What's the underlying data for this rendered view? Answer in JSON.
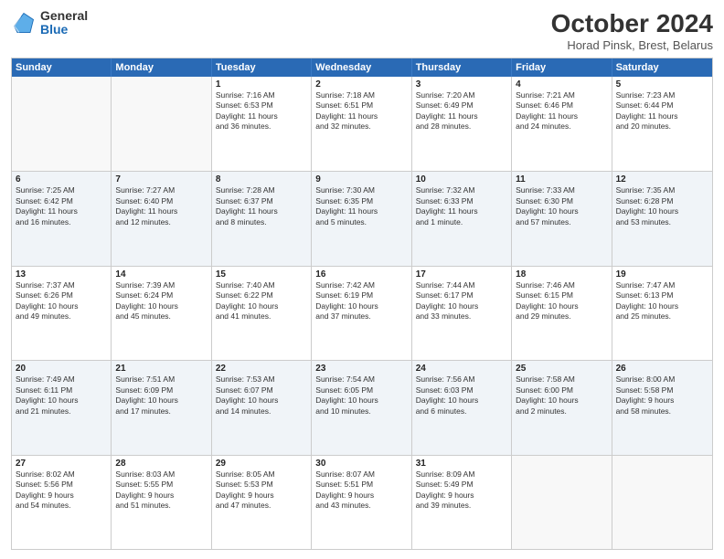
{
  "logo": {
    "general": "General",
    "blue": "Blue"
  },
  "header": {
    "month": "October 2024",
    "location": "Horad Pinsk, Brest, Belarus"
  },
  "days": [
    "Sunday",
    "Monday",
    "Tuesday",
    "Wednesday",
    "Thursday",
    "Friday",
    "Saturday"
  ],
  "weeks": [
    [
      {
        "day": "",
        "content": ""
      },
      {
        "day": "",
        "content": ""
      },
      {
        "day": "1",
        "content": "Sunrise: 7:16 AM\nSunset: 6:53 PM\nDaylight: 11 hours\nand 36 minutes."
      },
      {
        "day": "2",
        "content": "Sunrise: 7:18 AM\nSunset: 6:51 PM\nDaylight: 11 hours\nand 32 minutes."
      },
      {
        "day": "3",
        "content": "Sunrise: 7:20 AM\nSunset: 6:49 PM\nDaylight: 11 hours\nand 28 minutes."
      },
      {
        "day": "4",
        "content": "Sunrise: 7:21 AM\nSunset: 6:46 PM\nDaylight: 11 hours\nand 24 minutes."
      },
      {
        "day": "5",
        "content": "Sunrise: 7:23 AM\nSunset: 6:44 PM\nDaylight: 11 hours\nand 20 minutes."
      }
    ],
    [
      {
        "day": "6",
        "content": "Sunrise: 7:25 AM\nSunset: 6:42 PM\nDaylight: 11 hours\nand 16 minutes."
      },
      {
        "day": "7",
        "content": "Sunrise: 7:27 AM\nSunset: 6:40 PM\nDaylight: 11 hours\nand 12 minutes."
      },
      {
        "day": "8",
        "content": "Sunrise: 7:28 AM\nSunset: 6:37 PM\nDaylight: 11 hours\nand 8 minutes."
      },
      {
        "day": "9",
        "content": "Sunrise: 7:30 AM\nSunset: 6:35 PM\nDaylight: 11 hours\nand 5 minutes."
      },
      {
        "day": "10",
        "content": "Sunrise: 7:32 AM\nSunset: 6:33 PM\nDaylight: 11 hours\nand 1 minute."
      },
      {
        "day": "11",
        "content": "Sunrise: 7:33 AM\nSunset: 6:30 PM\nDaylight: 10 hours\nand 57 minutes."
      },
      {
        "day": "12",
        "content": "Sunrise: 7:35 AM\nSunset: 6:28 PM\nDaylight: 10 hours\nand 53 minutes."
      }
    ],
    [
      {
        "day": "13",
        "content": "Sunrise: 7:37 AM\nSunset: 6:26 PM\nDaylight: 10 hours\nand 49 minutes."
      },
      {
        "day": "14",
        "content": "Sunrise: 7:39 AM\nSunset: 6:24 PM\nDaylight: 10 hours\nand 45 minutes."
      },
      {
        "day": "15",
        "content": "Sunrise: 7:40 AM\nSunset: 6:22 PM\nDaylight: 10 hours\nand 41 minutes."
      },
      {
        "day": "16",
        "content": "Sunrise: 7:42 AM\nSunset: 6:19 PM\nDaylight: 10 hours\nand 37 minutes."
      },
      {
        "day": "17",
        "content": "Sunrise: 7:44 AM\nSunset: 6:17 PM\nDaylight: 10 hours\nand 33 minutes."
      },
      {
        "day": "18",
        "content": "Sunrise: 7:46 AM\nSunset: 6:15 PM\nDaylight: 10 hours\nand 29 minutes."
      },
      {
        "day": "19",
        "content": "Sunrise: 7:47 AM\nSunset: 6:13 PM\nDaylight: 10 hours\nand 25 minutes."
      }
    ],
    [
      {
        "day": "20",
        "content": "Sunrise: 7:49 AM\nSunset: 6:11 PM\nDaylight: 10 hours\nand 21 minutes."
      },
      {
        "day": "21",
        "content": "Sunrise: 7:51 AM\nSunset: 6:09 PM\nDaylight: 10 hours\nand 17 minutes."
      },
      {
        "day": "22",
        "content": "Sunrise: 7:53 AM\nSunset: 6:07 PM\nDaylight: 10 hours\nand 14 minutes."
      },
      {
        "day": "23",
        "content": "Sunrise: 7:54 AM\nSunset: 6:05 PM\nDaylight: 10 hours\nand 10 minutes."
      },
      {
        "day": "24",
        "content": "Sunrise: 7:56 AM\nSunset: 6:03 PM\nDaylight: 10 hours\nand 6 minutes."
      },
      {
        "day": "25",
        "content": "Sunrise: 7:58 AM\nSunset: 6:00 PM\nDaylight: 10 hours\nand 2 minutes."
      },
      {
        "day": "26",
        "content": "Sunrise: 8:00 AM\nSunset: 5:58 PM\nDaylight: 9 hours\nand 58 minutes."
      }
    ],
    [
      {
        "day": "27",
        "content": "Sunrise: 8:02 AM\nSunset: 5:56 PM\nDaylight: 9 hours\nand 54 minutes."
      },
      {
        "day": "28",
        "content": "Sunrise: 8:03 AM\nSunset: 5:55 PM\nDaylight: 9 hours\nand 51 minutes."
      },
      {
        "day": "29",
        "content": "Sunrise: 8:05 AM\nSunset: 5:53 PM\nDaylight: 9 hours\nand 47 minutes."
      },
      {
        "day": "30",
        "content": "Sunrise: 8:07 AM\nSunset: 5:51 PM\nDaylight: 9 hours\nand 43 minutes."
      },
      {
        "day": "31",
        "content": "Sunrise: 8:09 AM\nSunset: 5:49 PM\nDaylight: 9 hours\nand 39 minutes."
      },
      {
        "day": "",
        "content": ""
      },
      {
        "day": "",
        "content": ""
      }
    ]
  ]
}
